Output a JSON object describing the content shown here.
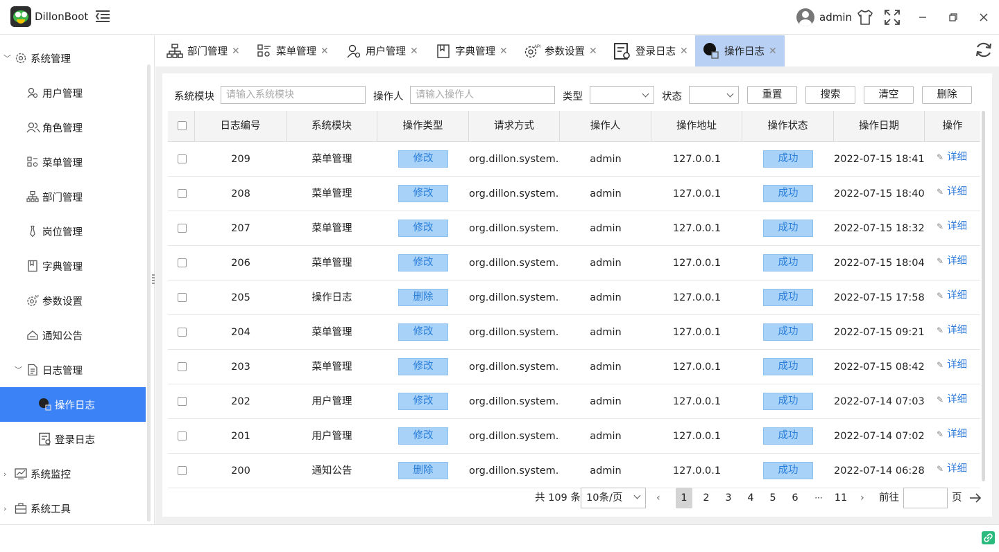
{
  "app": {
    "title": "DillonBoot",
    "user": "admin"
  },
  "sidebar": {
    "root": {
      "label": "系统管理"
    },
    "items": [
      {
        "label": "用户管理"
      },
      {
        "label": "角色管理"
      },
      {
        "label": "菜单管理"
      },
      {
        "label": "部门管理"
      },
      {
        "label": "岗位管理"
      },
      {
        "label": "字典管理"
      },
      {
        "label": "参数设置"
      },
      {
        "label": "通知公告"
      }
    ],
    "log_group": {
      "label": "日志管理"
    },
    "log_items": [
      {
        "label": "操作日志"
      },
      {
        "label": "登录日志"
      }
    ],
    "monitor": {
      "label": "系统监控"
    },
    "tools": {
      "label": "系统工具"
    }
  },
  "tabs": [
    {
      "label": "部门管理"
    },
    {
      "label": "菜单管理"
    },
    {
      "label": "用户管理"
    },
    {
      "label": "字典管理"
    },
    {
      "label": "参数设置"
    },
    {
      "label": "登录日志"
    },
    {
      "label": "操作日志"
    }
  ],
  "filters": {
    "module_label": "系统模块",
    "module_placeholder": "请输入系统模块",
    "operator_label": "操作人",
    "operator_placeholder": "请输入操作人",
    "type_label": "类型",
    "status_label": "状态",
    "reset": "重置",
    "search": "搜索",
    "clear": "清空",
    "delete": "删除"
  },
  "table": {
    "headers": [
      "日志编号",
      "系统模块",
      "操作类型",
      "请求方式",
      "操作人",
      "操作地址",
      "操作状态",
      "操作日期",
      "操作"
    ],
    "rows": [
      {
        "id": "209",
        "module": "菜单管理",
        "type": "修改",
        "method": "org.dillon.system....",
        "operator": "admin",
        "ip": "127.0.0.1",
        "status": "成功",
        "date": "2022-07-15 18:41...",
        "action": "详细"
      },
      {
        "id": "208",
        "module": "菜单管理",
        "type": "修改",
        "method": "org.dillon.system....",
        "operator": "admin",
        "ip": "127.0.0.1",
        "status": "成功",
        "date": "2022-07-15 18:40...",
        "action": "详细"
      },
      {
        "id": "207",
        "module": "菜单管理",
        "type": "修改",
        "method": "org.dillon.system....",
        "operator": "admin",
        "ip": "127.0.0.1",
        "status": "成功",
        "date": "2022-07-15 18:32...",
        "action": "详细"
      },
      {
        "id": "206",
        "module": "菜单管理",
        "type": "修改",
        "method": "org.dillon.system....",
        "operator": "admin",
        "ip": "127.0.0.1",
        "status": "成功",
        "date": "2022-07-15 18:04...",
        "action": "详细"
      },
      {
        "id": "205",
        "module": "操作日志",
        "type": "删除",
        "method": "org.dillon.system....",
        "operator": "admin",
        "ip": "127.0.0.1",
        "status": "成功",
        "date": "2022-07-15 17:58...",
        "action": "详细"
      },
      {
        "id": "204",
        "module": "菜单管理",
        "type": "修改",
        "method": "org.dillon.system....",
        "operator": "admin",
        "ip": "127.0.0.1",
        "status": "成功",
        "date": "2022-07-15 09:21...",
        "action": "详细"
      },
      {
        "id": "203",
        "module": "菜单管理",
        "type": "修改",
        "method": "org.dillon.system....",
        "operator": "admin",
        "ip": "127.0.0.1",
        "status": "成功",
        "date": "2022-07-15 08:42...",
        "action": "详细"
      },
      {
        "id": "202",
        "module": "用户管理",
        "type": "修改",
        "method": "org.dillon.system....",
        "operator": "admin",
        "ip": "127.0.0.1",
        "status": "成功",
        "date": "2022-07-14 07:03...",
        "action": "详细"
      },
      {
        "id": "201",
        "module": "用户管理",
        "type": "修改",
        "method": "org.dillon.system....",
        "operator": "admin",
        "ip": "127.0.0.1",
        "status": "成功",
        "date": "2022-07-14 07:02...",
        "action": "详细"
      },
      {
        "id": "200",
        "module": "通知公告",
        "type": "删除",
        "method": "org.dillon.system....",
        "operator": "admin",
        "ip": "127.0.0.1",
        "status": "成功",
        "date": "2022-07-14 06:28...",
        "action": "详细"
      }
    ]
  },
  "pagination": {
    "total": "共 109 条",
    "page_size": "10条/页",
    "pages": [
      "1",
      "2",
      "3",
      "4",
      "5",
      "6"
    ],
    "ellipsis": "···",
    "last": "11",
    "goto_label": "前往",
    "goto_suffix": "页"
  }
}
